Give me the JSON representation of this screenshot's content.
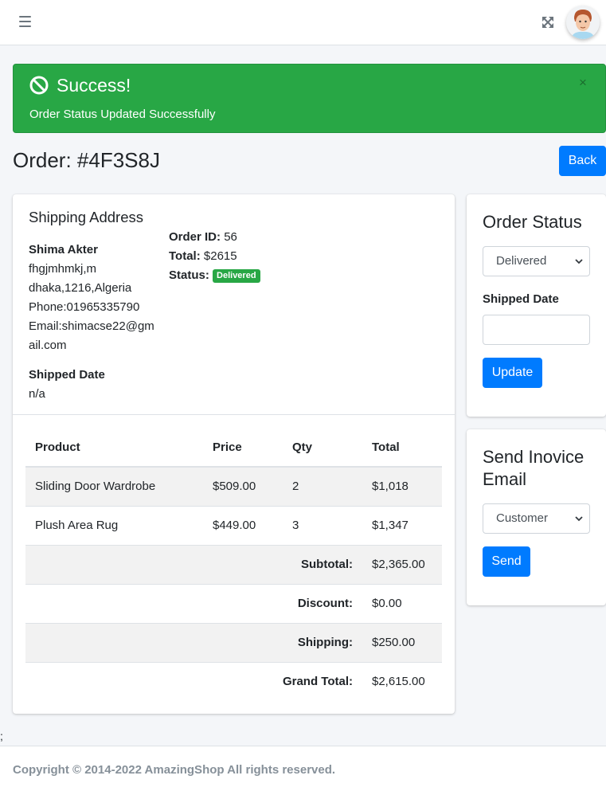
{
  "navbar": {
    "menu_icon": "hamburger-icon",
    "expand_icon": "expand-icon",
    "avatar_icon": "user-avatar"
  },
  "alert": {
    "icon": "ban-icon",
    "title": "Success!",
    "message": "Order Status Updated Successfully",
    "close": "×",
    "color": "#28a745"
  },
  "page": {
    "title": "Order: #4F3S8J",
    "back_label": "Back"
  },
  "shipping": {
    "heading": "Shipping Address",
    "name": "Shima Akter",
    "line1": "fhgjmhmkj,m",
    "line2": "dhaka,1216,Algeria",
    "phone": "Phone:01965335790",
    "email": "Email:shimacse22@gmail.com",
    "shipped_date_label": "Shipped Date",
    "shipped_date_value": "n/a"
  },
  "order_info": {
    "id_label": "Order ID:",
    "id_value": "56",
    "total_label": "Total:",
    "total_value": "$2615",
    "status_label": "Status:",
    "status_value": "Delivered",
    "status_color": "#28a745"
  },
  "items_table": {
    "headers": [
      "Product",
      "Price",
      "Qty",
      "Total"
    ],
    "rows": [
      [
        "Sliding Door Wardrobe",
        "$509.00",
        "2",
        "$1,018"
      ],
      [
        "Plush Area Rug",
        "$449.00",
        "3",
        "$1,347"
      ]
    ],
    "summary": [
      [
        "Subtotal:",
        "$2,365.00"
      ],
      [
        "Discount:",
        "$0.00"
      ],
      [
        "Shipping:",
        "$250.00"
      ],
      [
        "Grand Total:",
        "$2,615.00"
      ]
    ]
  },
  "status_card": {
    "heading": "Order Status",
    "selected_status": "Delivered",
    "shipped_date_label": "Shipped Date",
    "shipped_date_value": "",
    "update_label": "Update"
  },
  "email_card": {
    "heading": "Send Inovice Email",
    "selected_recipient": "Customer",
    "send_label": "Send"
  },
  "misc": {
    "stray_text": ";"
  },
  "footer": {
    "text": "Copyright © 2014-2022 AmazingShop All rights reserved."
  },
  "colors": {
    "primary": "#007bff",
    "success": "#28a745",
    "background": "#f4f6f9"
  }
}
